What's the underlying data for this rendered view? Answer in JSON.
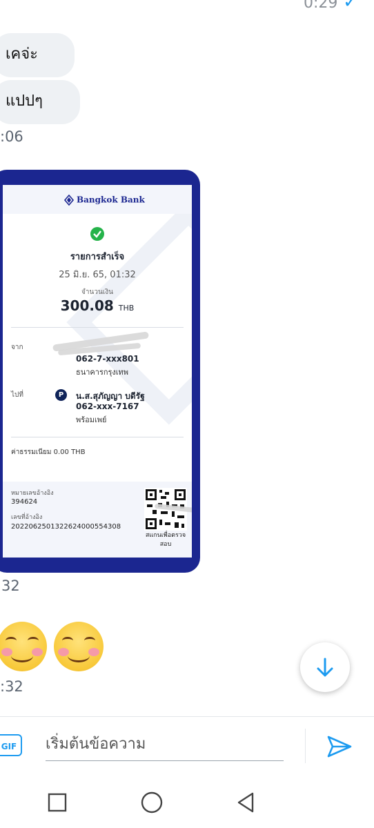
{
  "header": {
    "time_partial": "0:29"
  },
  "messages": {
    "bubble1": "เคจ่ะ",
    "bubble2": "แปปๆ",
    "time_a": ":06",
    "time_b": "32",
    "time_c": ":32"
  },
  "receipt": {
    "bank_name": "Bangkok Bank",
    "status": "รายการสำเร็จ",
    "datetime": "25 มิ.ย. 65, 01:32",
    "amount_label": "จำนวนเงิน",
    "amount": "300.08",
    "currency": "THB",
    "from_label": "จาก",
    "from_account": "062-7-xxx801",
    "from_bank": "ธนาคารกรุงเทพ",
    "to_label": "ไปที่",
    "to_name": "น.ส.สุภัญญา บดีรัฐ",
    "to_account": "062-xxx-7167",
    "to_method": "พร้อมเพย์",
    "fee": "ค่าธรรมเนียม 0.00 THB",
    "ref_label": "หมายเลขอ้างอิง",
    "ref_value": "394624",
    "ref2_label": "เลขที่อ้างอิง",
    "ref2_value": "20220625013226240005543​08",
    "qr_caption": "สแกนเพื่อตรวจสอบ"
  },
  "composer": {
    "gif_label": "GIF",
    "placeholder": "เริ่มต้นข้อความ"
  },
  "colors": {
    "accent": "#1d9bf0",
    "receipt_frame": "#1b2690",
    "bubble": "#eef1f4"
  }
}
